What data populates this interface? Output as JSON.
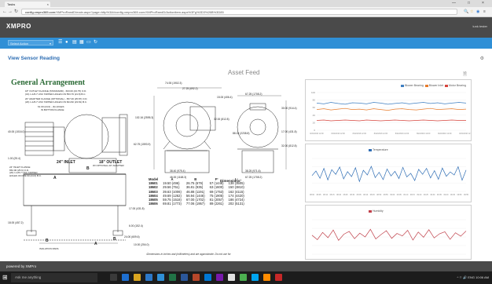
{
  "browser": {
    "tab_title": "Tasks",
    "tab_close": "×",
    "window_controls": {
      "minimize": "—",
      "maximize": "□",
      "close": "×"
    },
    "back_icon": "←",
    "forward_icon": "→",
    "reload_icon": "↻",
    "home_icon": "⌂",
    "url_host": "config.xmpro365.com",
    "url_path": "/XMProRandD/main.aspx?page=http%3A//config.xmpro365.com/XMProRandD/Actionitem.aspx%3Fg%3D3%26B%3D85",
    "extension_icons": [
      "search-icon",
      "star-icon",
      "extension-icon",
      "menu-icon"
    ]
  },
  "app": {
    "logo": "XMPRO",
    "user": "lunk tester",
    "toolbar": {
      "action_select_placeholder": "Select Action",
      "action_select_caret": "▾",
      "icons": [
        "list-icon",
        "chat-icon",
        "document-icon",
        "grid-icon",
        "window-icon",
        "refresh-icon"
      ]
    },
    "page_title": "View Sensor Reading",
    "settings_icon": "⚙",
    "asset_feed_title": "Asset Feed",
    "document_icon": "🗎",
    "footer": "powered by XMPro"
  },
  "drawing": {
    "title": "General Arrangement",
    "notes": [
      "18\" OUTLET FLANGE (STANDARD) - 603.00 (23.75) O.D.",
      "(16) 1-1/8-7 UNC TAPPED HOLES ON 553.76 (21.8) B.C.",
      "20\" ADAPTER FLANGE (OPTIONAL) - 657.00 (25.87) O.D.",
      "(20) 1-1/8-7 UNC TAPPED HOLES ON 604.82 (23.81) B.C.",
      "61.00 (24.0) - (6) HOLES",
      "IN BOTTOM FLANGE"
    ],
    "inlet_notes": [
      "24\" INLET FLANGE",
      "652.00 (25.6) O.D.",
      "(20) 1-1/8-7 UNC TAPPED",
      "HOLES ON 609.60 (24.0) B.C."
    ],
    "inlet_label": "24\" INLET",
    "outlet_label": "18\" OUTLET",
    "outlet_sub": "W/ OPTIONAL 20\" ADAPTER",
    "isolation_pads": "ISOLATION PADS",
    "dims": [
      "74.93 (1902.3)",
      "27.25 (692.2)",
      "15.00 (406.4)",
      "67.25 (1708.2)",
      "102.16 (2595.3)",
      "32.00 (812.8)",
      "88.15 (2238.8)",
      "62.75 (1593.9)",
      "38.40 (975.4)",
      "46.00 (1168.3)",
      "38.25 (971.6)",
      "67.25 (1708.2)",
      "40.00 (1016.0)",
      "30.00 (914.4)",
      "17.00 (431.8)",
      "32.00 (812.8)",
      "1.00 (25.4)",
      "18.00 (457.2)",
      "17.00 (431.8)",
      "6.00 (152.4)",
      "24.00 (609.6)",
      "10.00 (254.0)"
    ],
    "letters": [
      "A",
      "B",
      "B",
      "A",
      "B"
    ],
    "table_title": "Dimensions¹",
    "table_headers": [
      "Model",
      "A",
      "B",
      "F²",
      "L³"
    ],
    "table_rows": [
      [
        "18601",
        "19.50 (496)",
        "26.75 (679)",
        "57 (1448)",
        "138 (3505)"
      ],
      [
        "18602",
        "29.56 (751)",
        "36.81 (935)",
        "63 (1600)",
        "150 (3810)"
      ],
      [
        "18603",
        "39.63 (1006)",
        "46.88 (1191)",
        "69 (1753)",
        "162 (4115)"
      ],
      [
        "18604",
        "49.69 (1262)",
        "56.94 (1446)",
        "75 (1905)",
        "174 (4420)"
      ],
      [
        "18605",
        "59.75 (1518)",
        "67.00 (1702)",
        "81 (2057)",
        "186 (4724)"
      ],
      [
        "18606",
        "69.81 (1773)",
        "77.06 (1957)",
        "89 (2261)",
        "202 (5131)"
      ]
    ],
    "table_caption": "¹Dimensions in inches and (millimeters) and are approximate. Do not use for"
  },
  "chart_data": [
    {
      "type": "line",
      "title": "",
      "legend_position": "top-right",
      "ylim": [
        0,
        100
      ],
      "y_ticks": [
        "100",
        "80",
        "60",
        "40",
        "20",
        "0"
      ],
      "x_ticks": [
        "8/22/2016 12:00",
        "8/22/2016 12:00",
        "8/22/2016 12:00",
        "8/22/2016 12:00",
        "8/22/2016 12:00",
        "8/22/2016 12:00",
        "8/22/2016 12:00",
        "8/22/2016 12:00"
      ],
      "series": [
        {
          "name": "Blower Bearing",
          "color": "#3f7fc1",
          "values": [
            72,
            70,
            74,
            71,
            69,
            73,
            72,
            70,
            74,
            72,
            69,
            71,
            73,
            70,
            72,
            74,
            71,
            73,
            70,
            72,
            74,
            72
          ]
        },
        {
          "name": "Blower Inlet",
          "color": "#e87b2a",
          "values": [
            55,
            57,
            54,
            56,
            58,
            55,
            56,
            54,
            57,
            55,
            53,
            56,
            57,
            55,
            54,
            56,
            58,
            55,
            56,
            57,
            55,
            56
          ]
        },
        {
          "name": "Motor Bearing",
          "color": "#d6443c",
          "values": [
            26,
            27,
            25,
            26,
            27,
            26,
            25,
            27,
            26,
            25,
            26,
            27,
            26,
            25,
            26,
            27,
            26,
            25,
            26,
            27,
            26,
            26
          ]
        }
      ]
    },
    {
      "type": "line",
      "title": "",
      "legend_position": "top",
      "ylim": [
        0,
        100
      ],
      "series": [
        {
          "name": "Temperature",
          "color": "#2f6eb5",
          "values": [
            48,
            62,
            40,
            70,
            35,
            66,
            52,
            74,
            38,
            60,
            45,
            72,
            30,
            64,
            50,
            76,
            42,
            58,
            36,
            68,
            47,
            61,
            39,
            73,
            44,
            55,
            33,
            67,
            52,
            70,
            41,
            63,
            37,
            71,
            46,
            59,
            50,
            75,
            34,
            65
          ]
        }
      ],
      "x_ticks": [
        "08:00",
        "08:05",
        "08:10",
        "08:15",
        "08:20",
        "08:25",
        "08:30",
        "08:35",
        "08:40",
        "08:45",
        "08:50",
        "08:55",
        "09:00",
        "09:05",
        "09:10",
        "09:15",
        "09:20",
        "09:25",
        "09:30",
        "09:35",
        "09:40",
        "09:45",
        "09:50",
        "09:55"
      ]
    },
    {
      "type": "line",
      "title": "",
      "legend_position": "top",
      "ylim": [
        0,
        100
      ],
      "series": [
        {
          "name": "Humidity",
          "color": "#c0404a",
          "values": [
            55,
            42,
            63,
            48,
            70,
            40,
            58,
            66,
            45,
            61,
            50,
            72,
            44,
            57,
            68,
            46,
            60,
            53,
            69,
            41,
            64,
            49,
            71,
            47,
            59,
            65,
            43,
            62,
            52,
            67
          ]
        }
      ]
    }
  ],
  "taskbar": {
    "start_icon": "⊞",
    "search_placeholder": "Ask me anything",
    "tray_text": "^ ⚐ 🔊 ENG 10:06 AM"
  }
}
